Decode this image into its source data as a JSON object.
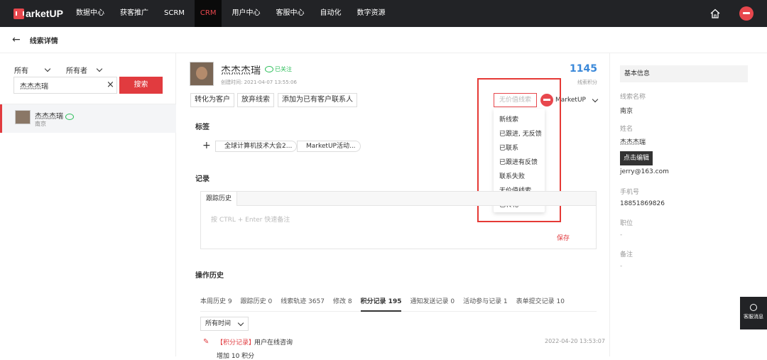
{
  "nav": {
    "logo": "arketUP",
    "items": [
      "数据中心",
      "获客推广",
      "SCRM",
      "CRM",
      "用户中心",
      "客服中心",
      "自动化",
      "数字资源"
    ],
    "active_index": 3
  },
  "subheader": {
    "back_icon": "←",
    "title": "线索详情"
  },
  "left": {
    "filter1": "所有",
    "filter2": "所有者",
    "search_value": "杰杰杰瑞",
    "search_button": "搜索",
    "lead": {
      "name": "杰杰杰瑞",
      "city": "南京"
    }
  },
  "main": {
    "name": "杰杰杰瑞",
    "followed": "已关注",
    "created": "创建时间: 2021-04-07 13:55:06",
    "score": "1145",
    "score_label": "线索积分",
    "actions": [
      "转化为客户",
      "放弃线索",
      "添加为已有客户联系人"
    ],
    "status_value": "无价值线索",
    "owner": "MarketUP",
    "dropdown": [
      "新线索",
      "已跟进, 无反馈",
      "已联系",
      "已跟进有反馈",
      "联系失败",
      "无价值线索",
      "已转化"
    ],
    "tags_title": "标签",
    "tags": [
      "全球计算机技术大会2...",
      "MarketUP活动..."
    ],
    "records_title": "记录",
    "notes_tab": "跟踪历史",
    "notes_placeholder": "按 CTRL + Enter 快速备注",
    "save": "保存",
    "ops_title": "操作历史",
    "op_tabs": [
      "本周历史 9",
      "跟踪历史 0",
      "线索轨迹 3657",
      "修改 8",
      "积分记录 195",
      "通知发送记录 0",
      "活动参与记录 1",
      "表单提交记录 10"
    ],
    "op_active": 4,
    "time_filter": "所有时间",
    "log": {
      "type": "【积分记录】",
      "desc": "用户在线咨询",
      "time": "2022-04-20 13:53:07",
      "extra": "增加 10 积分"
    }
  },
  "right": {
    "title": "基本信息",
    "fields": [
      {
        "label": "线索名称",
        "value": "南京"
      },
      {
        "label": "姓名",
        "value": "杰杰杰瑞"
      },
      {
        "label": "",
        "value": "jerry@163.com"
      },
      {
        "label": "手机号",
        "value": "18851869826"
      },
      {
        "label": "职位",
        "value": "-"
      },
      {
        "label": "备注",
        "value": "-"
      }
    ],
    "tooltip": "点击编辑"
  },
  "float": {
    "label": "客服消息"
  }
}
